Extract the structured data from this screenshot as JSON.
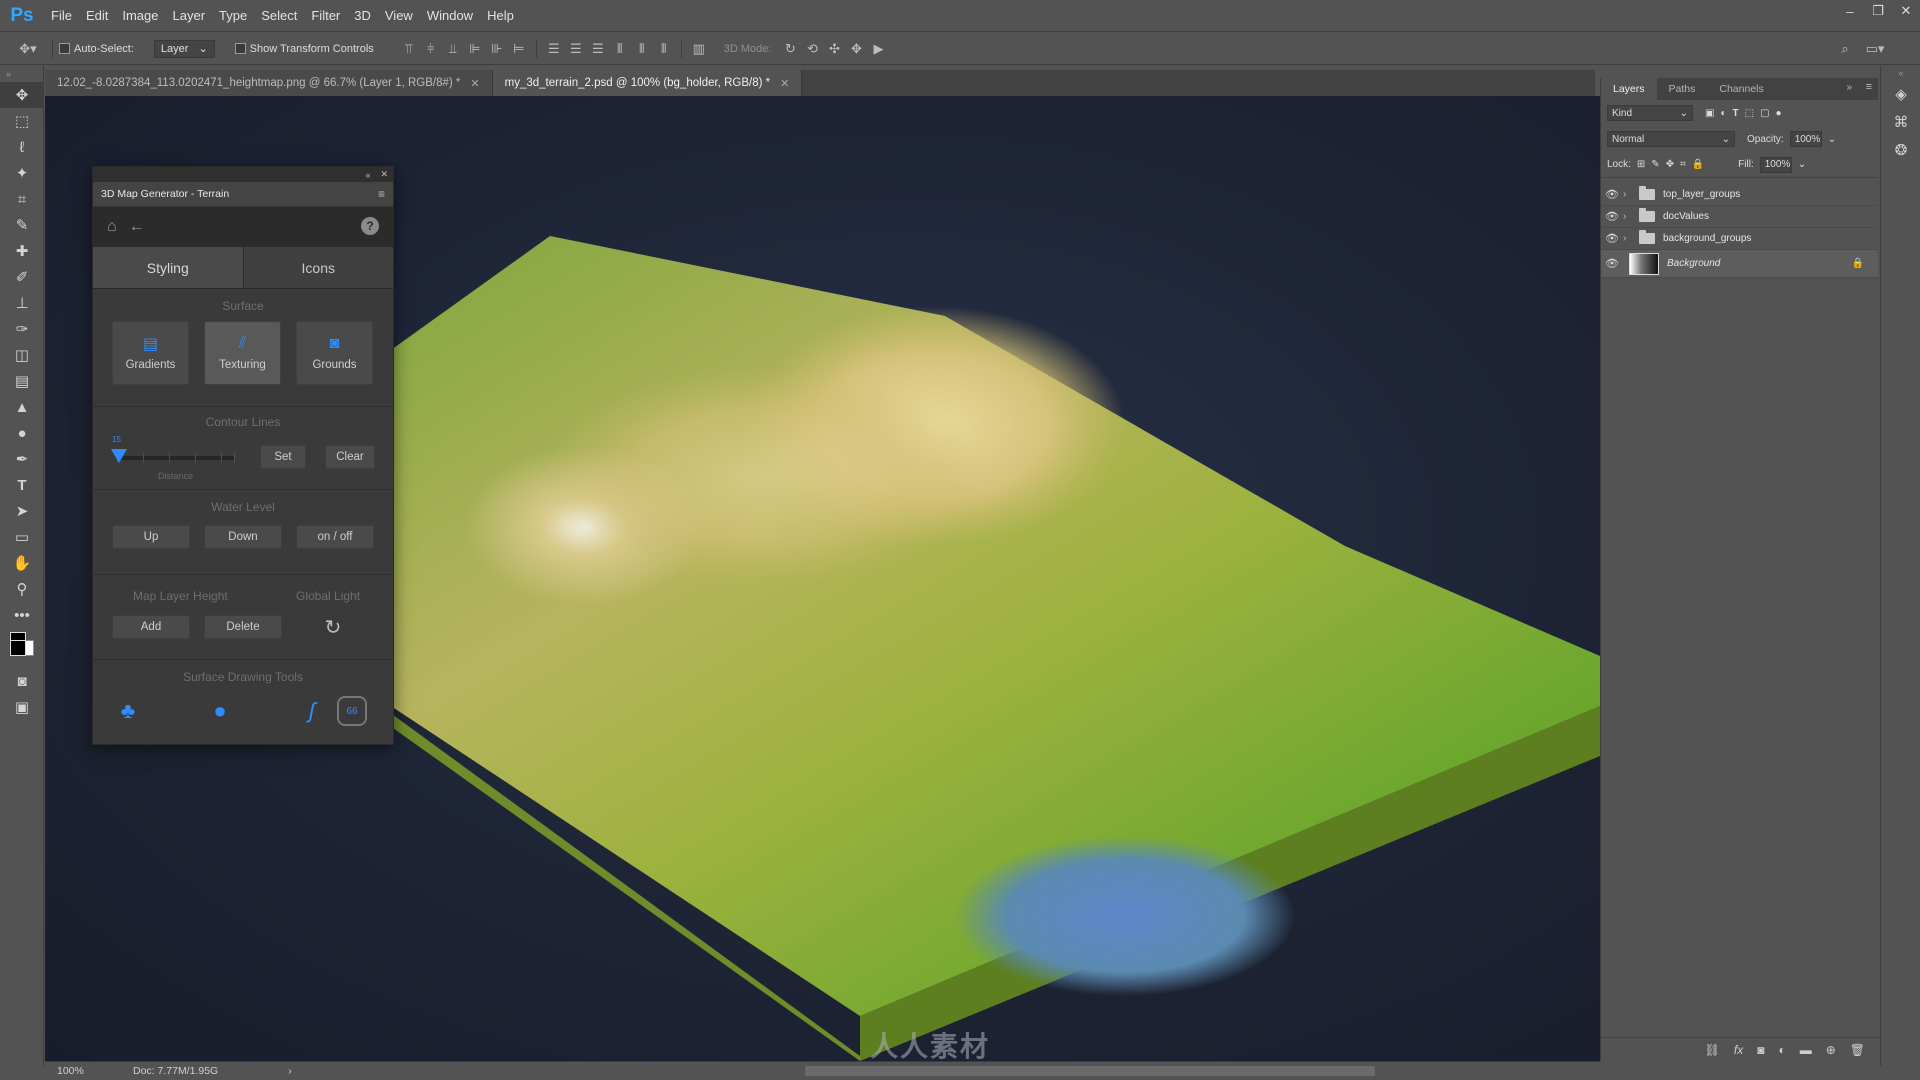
{
  "app": {
    "logo": "Ps"
  },
  "menu": [
    "File",
    "Edit",
    "Image",
    "Layer",
    "Type",
    "Select",
    "Filter",
    "3D",
    "View",
    "Window",
    "Help"
  ],
  "window_controls": {
    "minimize": "–",
    "restore": "❐",
    "close": "✕"
  },
  "options_bar": {
    "auto_select_label": "Auto-Select:",
    "auto_select_value": "Layer",
    "show_transform_label": "Show Transform Controls",
    "mode_3d_label": "3D Mode:"
  },
  "tabs": [
    {
      "label": "12.02_-8.0287384_113.0202471_heightmap.png @ 66.7% (Layer 1, RGB/8#) *",
      "active": false
    },
    {
      "label": "my_3d_terrain_2.psd @ 100% (bg_holder, RGB/8) *",
      "active": true
    }
  ],
  "plugin": {
    "title": "3D Map Generator - Terrain",
    "tabs": {
      "styling": "Styling",
      "icons": "Icons"
    },
    "surface": {
      "title": "Surface",
      "buttons": [
        "Gradients",
        "Texturing",
        "Grounds"
      ]
    },
    "contour": {
      "title": "Contour Lines",
      "slider_value": "15",
      "slider_caption": "Distance",
      "set": "Set",
      "clear": "Clear"
    },
    "water": {
      "title": "Water Level",
      "up": "Up",
      "down": "Down",
      "toggle": "on / off"
    },
    "layer_height": {
      "title": "Map Layer Height",
      "add": "Add",
      "delete": "Delete"
    },
    "global_light": {
      "title": "Global Light"
    },
    "drawing": {
      "title": "Surface Drawing Tools",
      "badge": "66"
    }
  },
  "layers_panel": {
    "tabs": [
      "Layers",
      "Paths",
      "Channels"
    ],
    "kind": "Kind",
    "blend_mode": "Normal",
    "opacity_label": "Opacity:",
    "opacity_value": "100%",
    "lock_label": "Lock:",
    "fill_label": "Fill:",
    "fill_value": "100%",
    "layers": [
      {
        "name": "top_layer_groups",
        "type": "group"
      },
      {
        "name": "docValues",
        "type": "group"
      },
      {
        "name": "background_groups",
        "type": "group"
      },
      {
        "name": "Background",
        "type": "image",
        "locked": true
      }
    ]
  },
  "status": {
    "zoom": "100%",
    "doc": "Doc: 7.77M/1.95G"
  },
  "watermark": "人人素材",
  "colors": {
    "accent_blue": "#2d8cff",
    "ps_blue": "#31a8ff"
  }
}
